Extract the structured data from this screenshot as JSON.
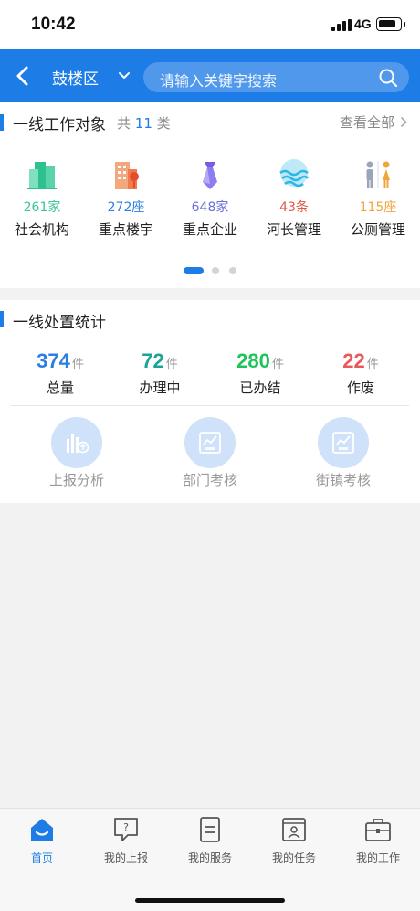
{
  "status_bar": {
    "time": "10:42",
    "network": "4G",
    "battery_level": 0.85
  },
  "header": {
    "district": "鼓楼区",
    "search_placeholder": "请输入关键字搜索"
  },
  "work_objects": {
    "title": "一线工作对象",
    "count_prefix": "共",
    "count": "11",
    "count_suffix": "类",
    "view_all": "查看全部",
    "items": [
      {
        "icon": "social-org-building-icon",
        "count": "261家",
        "label": "社会机构",
        "color": "#3cc49a"
      },
      {
        "icon": "key-building-icon",
        "count": "272座",
        "label": "重点楼宇",
        "color": "#2c7fe0"
      },
      {
        "icon": "key-enterprise-necktie-icon",
        "count": "648家",
        "label": "重点企业",
        "color": "#6a6fd8"
      },
      {
        "icon": "river-chief-waves-icon",
        "count": "43条",
        "label": "河长管理",
        "color": "#e05a4e"
      },
      {
        "icon": "public-toilet-icon",
        "count": "115座",
        "label": "公厕管理",
        "color": "#f0a53a"
      }
    ],
    "carousel_pages": 3,
    "carousel_active": 0
  },
  "disposal_stats": {
    "title": "一线处置统计",
    "stats": [
      {
        "value": "374",
        "unit": "件",
        "label": "总量",
        "color": "#2c7fe0"
      },
      {
        "value": "72",
        "unit": "件",
        "label": "办理中",
        "color": "#1aa39a"
      },
      {
        "value": "280",
        "unit": "件",
        "label": "已办结",
        "color": "#1fc35a"
      },
      {
        "value": "22",
        "unit": "件",
        "label": "作废",
        "color": "#e85a5a"
      }
    ],
    "functions": [
      {
        "icon": "report-analysis-chart-icon",
        "label": "上报分析"
      },
      {
        "icon": "department-assessment-icon",
        "label": "部门考核"
      },
      {
        "icon": "street-assessment-icon",
        "label": "街镇考核"
      }
    ]
  },
  "tab_bar": {
    "tabs": [
      {
        "icon": "home-icon",
        "label": "首页",
        "active": true
      },
      {
        "icon": "my-report-icon",
        "label": "我的上报",
        "active": false
      },
      {
        "icon": "my-service-icon",
        "label": "我的服务",
        "active": false
      },
      {
        "icon": "my-task-icon",
        "label": "我的任务",
        "active": false
      },
      {
        "icon": "my-work-briefcase-icon",
        "label": "我的工作",
        "active": false
      }
    ]
  },
  "colors": {
    "brand": "#1e7ce6",
    "background": "#f2f2f2"
  }
}
